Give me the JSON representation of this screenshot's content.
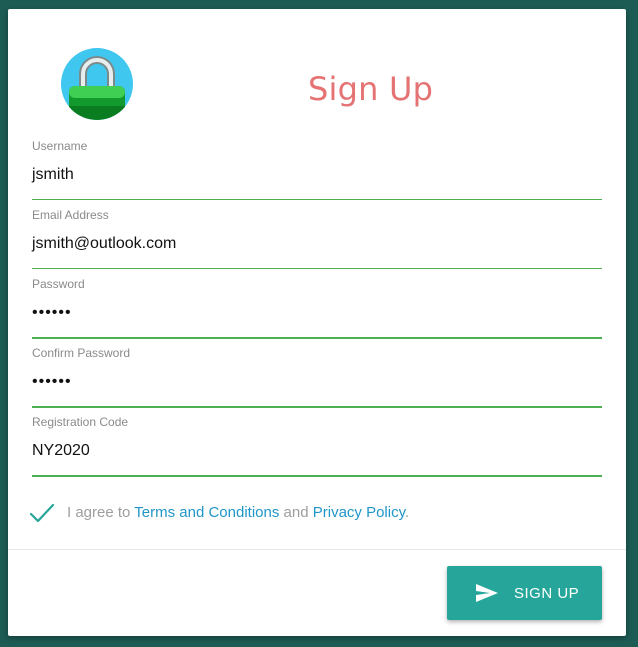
{
  "header": {
    "title": "Sign Up"
  },
  "fields": [
    {
      "label": "Username",
      "value": "jsmith"
    },
    {
      "label": "Email Address",
      "value": "jsmith@outlook.com"
    },
    {
      "label": "Password",
      "value": "••••••"
    },
    {
      "label": "Confirm Password",
      "value": "••••••"
    },
    {
      "label": "Registration Code",
      "value": "NY2020"
    }
  ],
  "agreement": {
    "checked": true,
    "prefix": "I agree to ",
    "terms_link": "Terms and Conditions",
    "middle": " and ",
    "privacy_link": "Privacy Policy",
    "suffix": "."
  },
  "actions": {
    "signup_label": "SIGN UP"
  },
  "colors": {
    "background": "#1d5c54",
    "title": "#e57373",
    "accent_line": "#4caf50",
    "button": "#26a69a",
    "link": "#2196c9"
  },
  "icons": {
    "avatar": "lock-icon",
    "checkbox": "check-icon",
    "button": "send-icon"
  }
}
